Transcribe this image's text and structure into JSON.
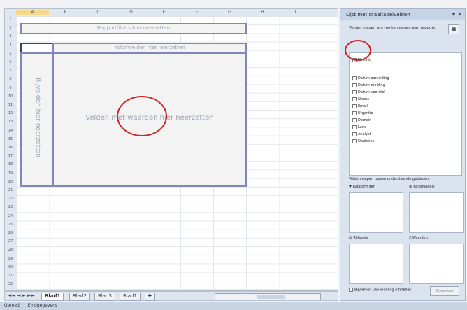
{
  "spreadsheet": {
    "col_headers": [
      "A",
      "B",
      "C",
      "D",
      "E",
      "F",
      "G",
      "H",
      "I"
    ],
    "row_headers": [
      "1",
      "2",
      "3",
      "4",
      "5",
      "6",
      "7",
      "8",
      "9",
      "10",
      "11",
      "12",
      "13",
      "14",
      "15",
      "16",
      "17",
      "18",
      "19",
      "20",
      "21",
      "22",
      "23",
      "24",
      "25",
      "26",
      "27",
      "28",
      "29",
      "30",
      "31",
      "32"
    ],
    "report_filter_text": "Rapportfilters hier neerzetten",
    "column_labels_text": "Kolomvelden hier neerzetten",
    "row_labels_text": "Rijvelden hier neerzetten",
    "values_text": "Velden met waarden hier neerzetten"
  },
  "sheet_tabs": [
    "Blad1",
    "Blad2",
    "Blad3",
    "Blad1"
  ],
  "statusbar": {
    "left": "Gereed",
    "second": "Eindgegevens"
  },
  "field_list": {
    "title": "Lijst met draaitabelvelden",
    "instruction": "Velden kiezen om toe te voegen aan rapport:",
    "fields": [
      "Vinklist",
      "Datum aanleiding",
      "Datum melding",
      "Datum voorstel",
      "Status",
      "Email",
      "Urgentie",
      "Domein",
      "Land",
      "Analyst",
      "Statistiek"
    ],
    "areas_instruction": "Velden slepen tussen onderstaande gebieden:",
    "area_labels": [
      "Rapportfilter",
      "Kolomlabels",
      "Rijlabels",
      "Waarden"
    ],
    "defer_label": "Bijwerken van indeling uitstellen",
    "update_button": "Bijwerken"
  }
}
